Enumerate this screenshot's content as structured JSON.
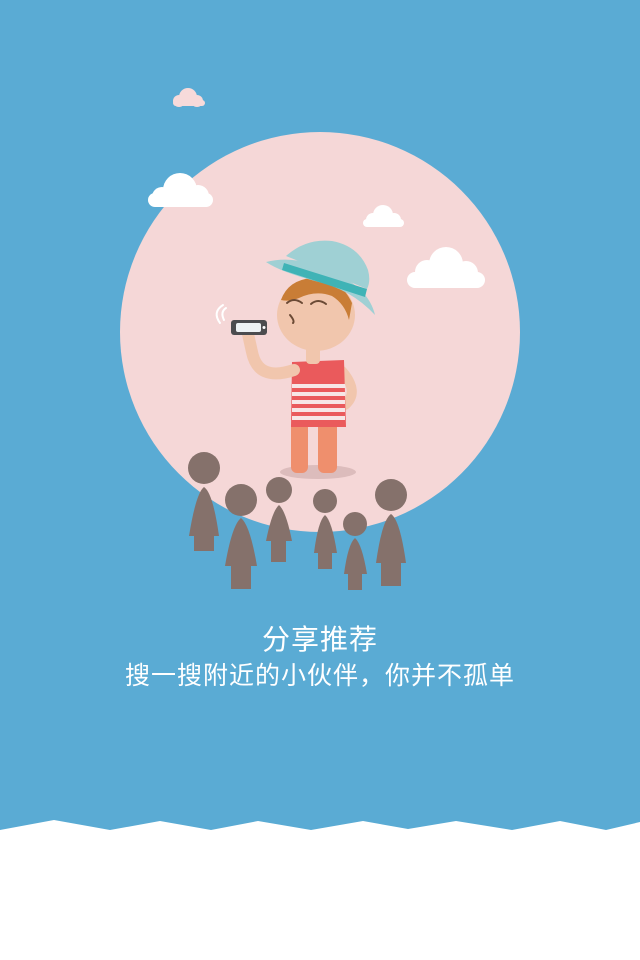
{
  "onboarding": {
    "title": "分享推荐",
    "subtitle": "搜一搜附近的小伙伴，你并不孤单"
  },
  "colors": {
    "sky": "#5aabd4",
    "circle": "#f5d7d7",
    "crowd": "#85716b",
    "hat": "#9fd0d4",
    "hat_band": "#3fb3b6",
    "shirt": "#ea5a5c",
    "pants": "#ef8f6d",
    "skin": "#f1c6ad",
    "bottom": "#ffffff"
  },
  "icons": {
    "phone": "smartphone-icon",
    "signal": "signal-wave-icon"
  }
}
